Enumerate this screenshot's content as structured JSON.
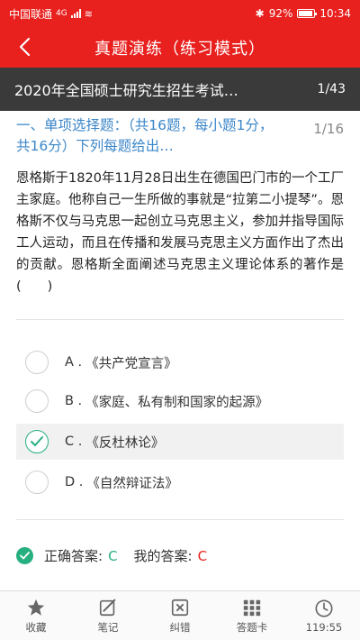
{
  "status": {
    "carrier": "中国联通",
    "network": "4G",
    "battery": "92%",
    "time": "10:34"
  },
  "nav": {
    "title": "真题演练（练习模式）"
  },
  "exam": {
    "name": "2020年全国硕士研究生招生考试…",
    "progress": "1/43"
  },
  "section": {
    "heading": "一、单项选择题：（共16题，每小题1分，共16分）下列每题给出…",
    "count": "1/16"
  },
  "question": {
    "text": "恩格斯于1820年11月28日出生在德国巴门市的一个工厂主家庭。他称自己一生所做的事就是“拉第二小提琴”。恩格斯不仅与马克思一起创立马克思主义，参加并指导国际工人运动，而且在传播和发展马克思主义方面作出了杰出的贡献。恩格斯全面阐述马克思主义理论体系的著作是(　　)"
  },
  "options": [
    {
      "letter": "A .",
      "text": "《共产党宣言》",
      "selected": false
    },
    {
      "letter": "B .",
      "text": "《家庭、私有制和国家的起源》",
      "selected": false
    },
    {
      "letter": "C .",
      "text": "《反杜林论》",
      "selected": true
    },
    {
      "letter": "D .",
      "text": "《自然辩证法》",
      "selected": false
    }
  ],
  "answer": {
    "correct_label": "正确答案:",
    "correct_value": "C",
    "my_label": "我的答案:",
    "my_value": "C"
  },
  "tabs": [
    {
      "icon": "star-icon",
      "label": "收藏"
    },
    {
      "icon": "note-icon",
      "label": "笔记"
    },
    {
      "icon": "error-report-icon",
      "label": "纠错"
    },
    {
      "icon": "answer-card-icon",
      "label": "答题卡"
    },
    {
      "icon": "clock-icon",
      "label": "119:55"
    }
  ],
  "colors": {
    "brand_red": "#e8201e",
    "exam_bar": "#3a3a3a",
    "section_blue": "#3b86c9",
    "correct_green": "#26b07f"
  }
}
